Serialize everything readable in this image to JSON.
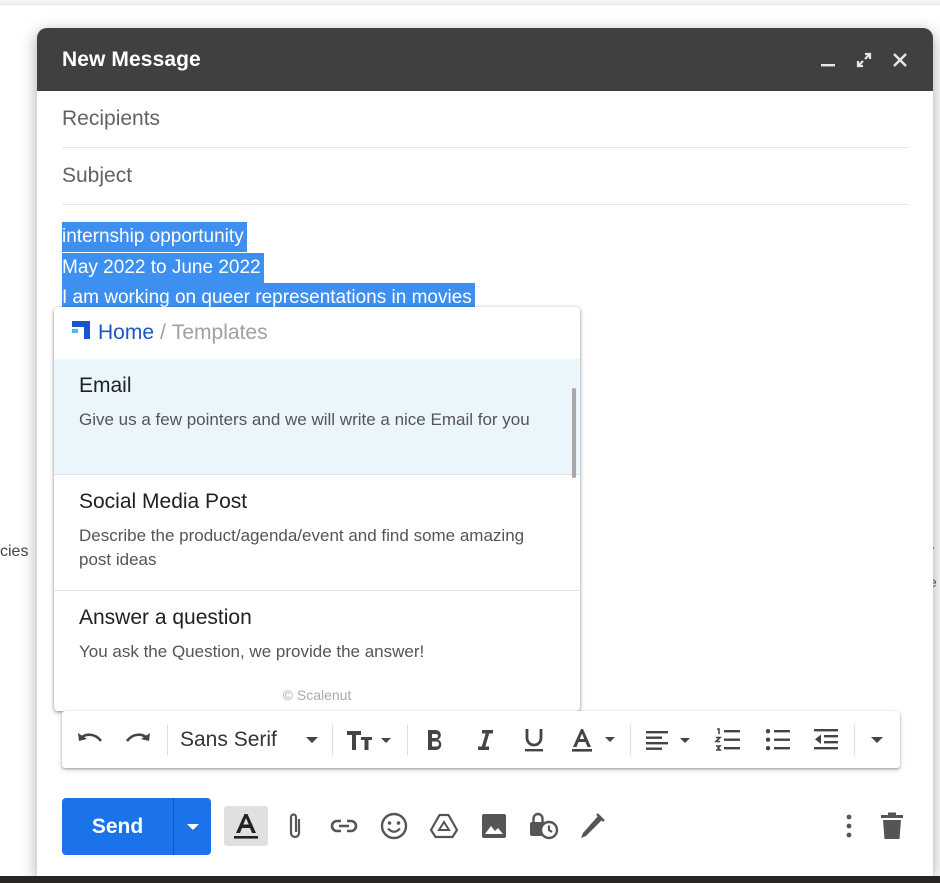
{
  "background": {
    "left_text": "cies",
    "right_text_1": "r",
    "right_text_2": "e"
  },
  "compose": {
    "title": "New Message",
    "recipients_placeholder": "Recipients",
    "subject_placeholder": "Subject",
    "body_lines": [
      "internship opportunity",
      "May 2022 to June 2022",
      "I am working on queer representations in movies"
    ]
  },
  "popup": {
    "breadcrumb": {
      "home": "Home",
      "separator": "/",
      "current": "Templates"
    },
    "items": [
      {
        "title": "Email",
        "description": "Give us a few pointers and we will write a nice Email for you"
      },
      {
        "title": "Social Media Post",
        "description": "Describe the product/agenda/event and find some amazing post ideas"
      },
      {
        "title": "Answer a question",
        "description": "You ask the Question, we provide the answer!"
      }
    ],
    "powered_by": "© Scalenut"
  },
  "format_bar": {
    "font": "Sans Serif"
  },
  "actions": {
    "send_label": "Send"
  },
  "colors": {
    "titlebar": "#404040",
    "selection": "#3d8ff0",
    "send": "#1a73e8",
    "home_link": "#1a56c8",
    "active_item": "#eaf6fc"
  }
}
